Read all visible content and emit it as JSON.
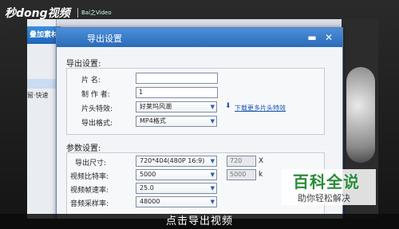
{
  "brand": {
    "logo_text": "秒dong视频",
    "logo_small": "Bai之Video"
  },
  "background_app": {
    "left_tab": "叠加素材",
    "left_row": "留·快速"
  },
  "dialog": {
    "title": "导出设置",
    "export_group": {
      "label": "导出设置:",
      "fields": {
        "name_label": "片    名:",
        "name_value": "",
        "author_label": "制 作 者:",
        "author_value": "1",
        "intro_label": "片头特效:",
        "intro_value": "好莱坞风潮",
        "format_label": "导出格式:",
        "format_value": "MP4格式"
      },
      "download_link": "下载更多片头特效"
    },
    "params_group": {
      "label": "参数设置:",
      "fields": {
        "size_label": "导出尺寸:",
        "size_value": "720*404(480P 16:9)",
        "size_w": "720",
        "size_x": "X",
        "video_bitrate_label": "视频比特率:",
        "video_bitrate_value": "5000",
        "video_bitrate_side": "5000",
        "video_bitrate_unit": "k",
        "framerate_label": "视频帧速率:",
        "framerate_value": "25.0",
        "audio_label": "音频采样率:",
        "audio_value": "48000"
      }
    }
  },
  "caption": "点击导出视频",
  "watermark": {
    "title": "百科全说",
    "subtitle": "助你轻松解决"
  }
}
